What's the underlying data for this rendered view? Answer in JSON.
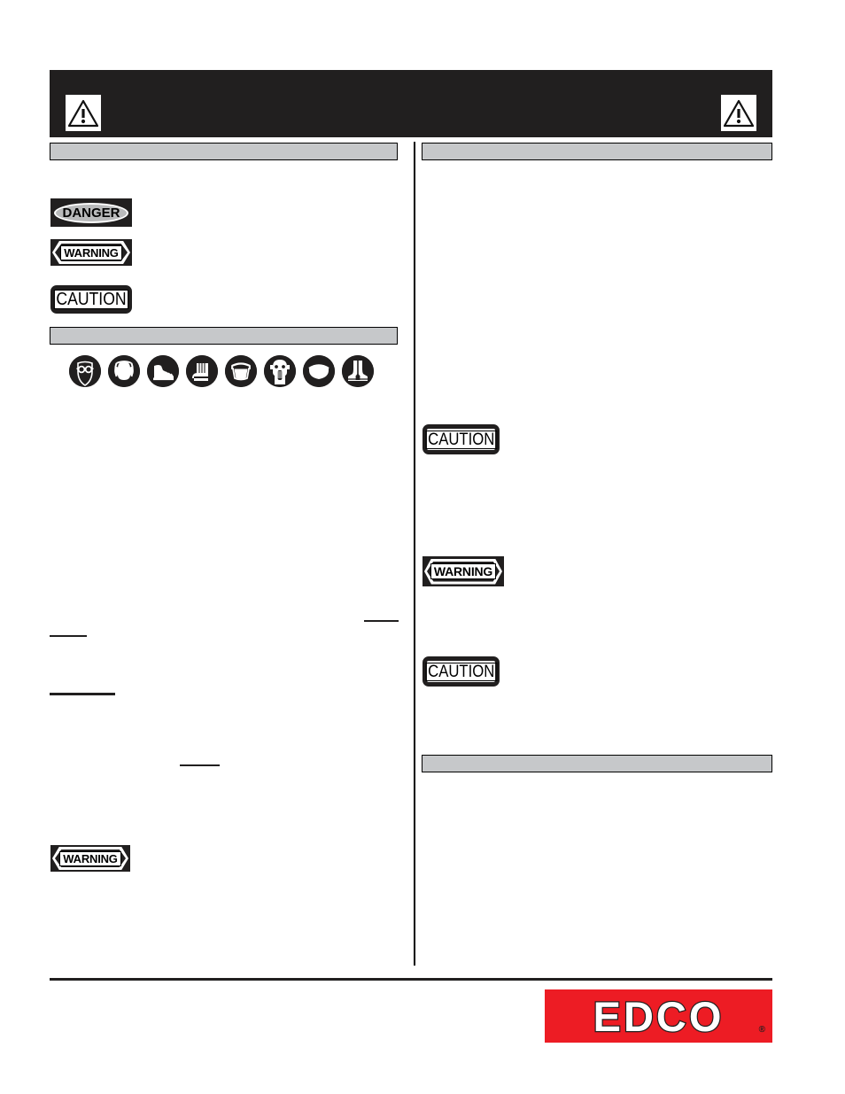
{
  "document": {
    "type": "safety-manual-page",
    "banner": {
      "title": "",
      "background_color": "#211f1f",
      "icon_left": "warning-triangle-icon",
      "icon_right": "warning-triangle-icon"
    },
    "colors": {
      "black": "#211f1f",
      "section_bar_gray": "#c6c8ca",
      "danger_oval_gray": "#b9babb",
      "logo_red": "#ed1c24",
      "white": "#ffffff"
    }
  },
  "left_column": {
    "section_header_1": "",
    "signal_words": [
      {
        "id": "danger",
        "label": "DANGER",
        "style": "oval-on-black",
        "body": ""
      },
      {
        "id": "warning",
        "label": "WARNING",
        "style": "hexagon-on-black",
        "body": ""
      },
      {
        "id": "caution",
        "label": "CAUTION",
        "style": "outlined-box",
        "body": ""
      }
    ],
    "section_header_2": "",
    "ppe_icons": [
      {
        "name": "safety-glasses-icon",
        "label": ""
      },
      {
        "name": "ear-protection-icon",
        "label": ""
      },
      {
        "name": "safety-boots-icon",
        "label": ""
      },
      {
        "name": "safety-gloves-icon",
        "label": ""
      },
      {
        "name": "face-shield-icon",
        "label": ""
      },
      {
        "name": "respirator-icon",
        "label": ""
      },
      {
        "name": "hard-hat-icon",
        "label": ""
      },
      {
        "name": "safety-vest-icon",
        "label": ""
      }
    ],
    "body_text_1": "",
    "body_text_2": "",
    "body_text_3": "",
    "warning_bottom": {
      "label": "WARNING",
      "body": ""
    }
  },
  "right_column": {
    "section_header_1": "",
    "body_text_1": "",
    "caution_1": {
      "label": "CAUTION",
      "body": ""
    },
    "warning_1": {
      "label": "WARNING",
      "body": ""
    },
    "caution_2": {
      "label": "CAUTION",
      "body": ""
    },
    "section_header_2": "",
    "body_text_2": ""
  },
  "footer": {
    "logo_text": "EDCO",
    "registered_mark": "®",
    "page_number": ""
  }
}
